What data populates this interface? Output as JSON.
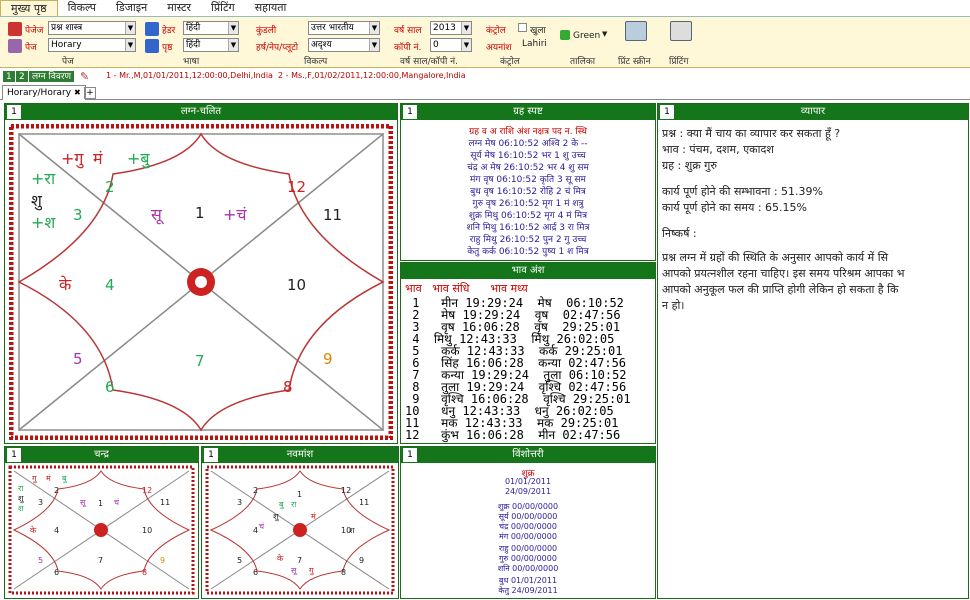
{
  "menu": [
    "मुख्य पृष्ठ",
    "विकल्प",
    "डिजाइन",
    "मास्टर",
    "प्रिंटिंग",
    "सहायता"
  ],
  "ribbon": {
    "page_label": "पेजेज",
    "page_select": "प्रश्न शास्त्र",
    "page2_label": "पेज",
    "page2_select": "Horary",
    "page_group": "पेज",
    "header_label": "हेडर",
    "header_select": "हिंदी",
    "body_label": "पृष्ठ",
    "body_select": "हिंदी",
    "lang_group": "भाषा",
    "kundli_label": "कुंडली",
    "kundli_select": "उत्तर भारतीय",
    "harsh_label": "हर्ष/नेप/प्लूटो",
    "harsh_select": "अदृश्य",
    "option_group": "विकल्प",
    "year_label": "वर्ष साल",
    "year_select": "2013",
    "copy_label": "कॉपी नं.",
    "copy_select": "0",
    "year_group": "वर्ष साल/कॉपी नं.",
    "control_label": "कंट्रोल",
    "open_label": "खुला",
    "ayanamsa_label": "अयनांश",
    "ayanamsa_value": "Lahiri",
    "control_group": "कंट्रोल",
    "color_value": "Green",
    "color_group": "तालिका",
    "print_screen": "प्रिंट स्क्रीन",
    "printing": "प्रिंटिंग"
  },
  "records": {
    "n1": "1",
    "n2": "2",
    "lagna": "लग्न विवरण",
    "r1": "1 - Mr.,M,01/01/2011,12:00:00,Delhi,India",
    "r2": "2 - Ms.,F,01/02/2011,12:00:00,Mangalore,India"
  },
  "tab": {
    "label": "Horary/Horary",
    "close": "✖",
    "plus": "+"
  },
  "lagna": {
    "num": "1",
    "title": "लग्न-चलित",
    "houses": [
      "1",
      "2",
      "3",
      "4",
      "5",
      "6",
      "7",
      "8",
      "9",
      "10",
      "11",
      "12"
    ],
    "planets": [
      "+गु",
      "मं",
      "+बु",
      "+रा",
      "शु",
      "+श",
      "के",
      "सू",
      "+चं"
    ]
  },
  "graha": {
    "num": "1",
    "title": "ग्रह स्पष्ट",
    "header": "ग्रह व अ राशि    अंश    नक्षत्र पद न. स्थि",
    "rows": [
      "लग्न      मेष 06:10:52  अश्वि  2  के   --",
      "सूर्य      मेष 16:10:52  भर   1  शु उच्च",
      "चंद्र   अ मेष 26:10:52  भर   4  शु सम",
      "मंग      वृष 06:10:52  कृति  3  सू सम",
      "बुध      वृष 16:10:52  रोहि  2  चं मित्र",
      "गुरु      वृष 26:10:52  मृग  1  मं शत्रु",
      "शुक्र     मिथु 06:10:52  मृग  4  मं मित्र",
      "शनि     मिथु 16:10:52  आर्द्र  3  रा मित्र",
      "राहु      मिथु 26:10:52  पुन  2  गु उच्च",
      "केतु      कर्क 06:10:52  पुष्य  1  श मित्र"
    ]
  },
  "bhava": {
    "title": "भाव अंश",
    "header": "भाव   भाव संधि      भाव मध्य",
    "rows": [
      " 1   मीन 19:29:24  मेष  06:10:52",
      " 2   मेष 19:29:24  वृष  02:47:56",
      " 3   वृष 16:06:28  वृष  29:25:01",
      " 4  मिथु 12:43:33  मिथु 26:02:05",
      " 5   कर्क 12:43:33  कर्क 29:25:01",
      " 6   सिंह 16:06:28  कन्या 02:47:56",
      " 7   कन्या 19:29:24  तुला 06:10:52",
      " 8   तुला 19:29:24  वृश्चि 02:47:56",
      " 9   वृश्चि 16:06:28  वृश्चि 29:25:01",
      "10   धनु 12:43:33  धनु 26:02:05",
      "11   मक 12:43:33  मक 29:25:01",
      "12   कुंभ 16:06:28  मीन 02:47:56"
    ]
  },
  "vyapar": {
    "num": "1",
    "title": "व्यापार",
    "q": "प्रश्न :   क्या मैं चाय का व्यापार कर सकता हूँ ?",
    "bhava": "भाव :  पंचम, दशम, एकादश",
    "graha": "ग्रह :     शुक्र  गुरु",
    "prob": "कार्य पूर्ण होने की सम्भावना : 51.39%",
    "time": "कार्य पूर्ण होने का समय : 65.15%",
    "conc": "निष्कर्ष :",
    "l1": "प्रश्न लग्न में ग्रहों की स्थिति के अनुसार आपको कार्य में सि",
    "l2": "आपको प्रयत्नशील रहना चाहिए। इस समय परिश्रम आपका भ",
    "l3": "आपको अनुकूल फल की प्राप्ति होगी लेकिन हो सकता है कि",
    "l4": "न हो।"
  },
  "chandra": {
    "num": "1",
    "title": "चन्द्र",
    "houses": [
      "1",
      "2",
      "3",
      "4",
      "5",
      "6",
      "7",
      "8",
      "9",
      "10",
      "11",
      "12"
    ],
    "planets": [
      "गु",
      "मं",
      "बु",
      "रा",
      "शु",
      "श",
      "सू",
      "चं",
      "के"
    ]
  },
  "navamsha": {
    "num": "1",
    "title": "नवमांश",
    "houses": [
      "1",
      "2",
      "3",
      "4",
      "5",
      "6",
      "7",
      "8",
      "9",
      "10",
      "11",
      "12"
    ],
    "planets": [
      "बु",
      "रा",
      "शु",
      "मं",
      "चं",
      "श",
      "के",
      "सू",
      "गु"
    ]
  },
  "vimshottari": {
    "num": "1",
    "title": "विंशोत्तरी",
    "lord": "शुक्र",
    "start": "01/01/2011",
    "end": "24/09/2011",
    "rows": [
      "शुक्र 00/00/0000",
      "सूर्य 00/00/0000",
      "चंद्र 00/00/0000",
      "मंग 00/00/0000",
      "राहु 00/00/0000",
      "गुरु 00/00/0000",
      "शनि 00/00/0000",
      "बुध 01/01/2011",
      "केतु 24/09/2011"
    ]
  }
}
